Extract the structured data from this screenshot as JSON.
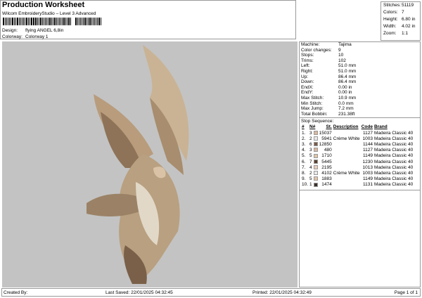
{
  "header": {
    "title": "Production Worksheet",
    "subtitle": "Wilcom EmbroideryStudio – Level 3 Advanced",
    "design_label": "Design:",
    "design": "flying ANGEL 6,8in",
    "colorway_label": "Colorway:",
    "colorway": "Colorway 1"
  },
  "stats": [
    {
      "k": "Stitches:",
      "v": "51119"
    },
    {
      "k": "Colors:",
      "v": "7"
    },
    {
      "k": "Height:",
      "v": "6.80 in"
    },
    {
      "k": "Width:",
      "v": "4.02 in"
    },
    {
      "k": "Zoom:",
      "v": "1:1"
    }
  ],
  "info": [
    {
      "k": "Machine:",
      "v": "Tajima"
    },
    {
      "k": "Color changes:",
      "v": "9"
    },
    {
      "k": "Stops:",
      "v": "10"
    },
    {
      "k": "Trims:",
      "v": "102"
    },
    {
      "k": "Left:",
      "v": "51.0 mm"
    },
    {
      "k": "Right:",
      "v": "51.0 mm"
    },
    {
      "k": "Up:",
      "v": "86.4 mm"
    },
    {
      "k": "Down:",
      "v": "86.4 mm"
    },
    {
      "k": "EndX:",
      "v": "0.00 in"
    },
    {
      "k": "EndY:",
      "v": "0.00 in"
    },
    {
      "k": "Max Stitch:",
      "v": "10.9 mm"
    },
    {
      "k": "Min Stitch:",
      "v": "0.0 mm"
    },
    {
      "k": "Max Jump:",
      "v": "7.2 mm"
    },
    {
      "k": "Total Bobbin:",
      "v": "231.38ft"
    }
  ],
  "stop_sequence": {
    "title": "Stop Sequence:",
    "headers": [
      "#",
      "N#",
      "St.",
      "Description",
      "Code",
      "Brand"
    ],
    "rows": [
      {
        "n": "1.",
        "needle": "3",
        "color": "#d9b8a0",
        "st": "15037",
        "desc": "",
        "code": "1127",
        "brand": "Madeira Classic 40"
      },
      {
        "n": "2.",
        "needle": "2",
        "color": "#e8e8e8",
        "st": "5941",
        "desc": "Crème White",
        "code": "1003",
        "brand": "Madeira Classic 40"
      },
      {
        "n": "3.",
        "needle": "6",
        "color": "#7a5a48",
        "st": "12850",
        "desc": "",
        "code": "1144",
        "brand": "Madeira Classic 40"
      },
      {
        "n": "4.",
        "needle": "3",
        "color": "#d9b8a0",
        "st": "480",
        "desc": "",
        "code": "1127",
        "brand": "Madeira Classic 40"
      },
      {
        "n": "5.",
        "needle": "5",
        "color": "#e0c4a8",
        "st": "1710",
        "desc": "",
        "code": "1149",
        "brand": "Madeira Classic 40"
      },
      {
        "n": "6.",
        "needle": "7",
        "color": "#5a4030",
        "st": "5445",
        "desc": "",
        "code": "1230",
        "brand": "Madeira Classic 40"
      },
      {
        "n": "7.",
        "needle": "4",
        "color": "#ecccbc",
        "st": "2195",
        "desc": "",
        "code": "1013",
        "brand": "Madeira Classic 40"
      },
      {
        "n": "8.",
        "needle": "2",
        "color": "#e8e8e8",
        "st": "4102",
        "desc": "Crème White",
        "code": "1003",
        "brand": "Madeira Classic 40"
      },
      {
        "n": "9.",
        "needle": "5",
        "color": "#e0c4a8",
        "st": "1883",
        "desc": "",
        "code": "1149",
        "brand": "Madeira Classic 40"
      },
      {
        "n": "10.",
        "needle": "1",
        "color": "#3a302a",
        "st": "1474",
        "desc": "",
        "code": "1131",
        "brand": "Madeira Classic 40"
      }
    ]
  },
  "footer": {
    "created": "Created By:",
    "saved": "Last Saved: 22/01/2025 04:32:45",
    "printed": "Printed: 22/01/2025 04:32:49",
    "page": "Page 1 of 1"
  }
}
